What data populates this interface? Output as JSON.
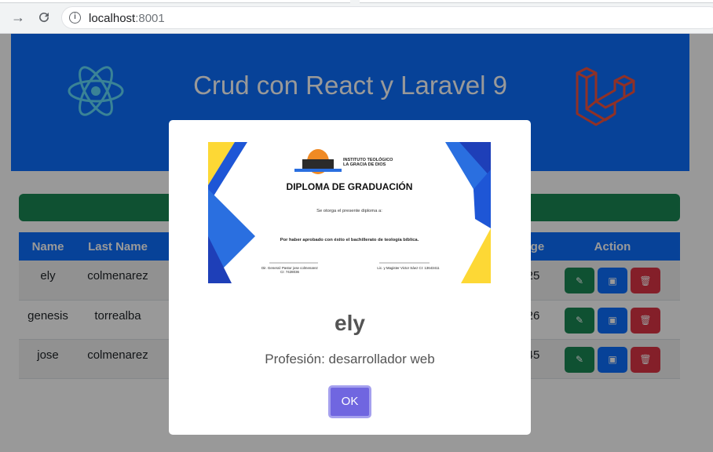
{
  "browser": {
    "url_host": "localhost",
    "url_port": ":8001"
  },
  "header": {
    "title": "Crud con React y Laravel 9",
    "react_logo": "react-logo",
    "laravel_logo": "laravel-logo"
  },
  "table": {
    "headers": {
      "name": "Name",
      "last_name": "Last Name",
      "age": "Age",
      "action": "Action"
    },
    "rows": [
      {
        "name": "ely",
        "last_name": "colmenarez",
        "age": "25"
      },
      {
        "name": "genesis",
        "last_name": "torrealba",
        "age": "26"
      },
      {
        "name": "jose",
        "last_name": "colmenarez",
        "age": "45"
      }
    ]
  },
  "modal": {
    "name": "ely",
    "profession": "Profesión: desarrollador web",
    "ok_label": "OK",
    "diploma": {
      "institute_line1": "INSTITUTO TEOLÓGICO",
      "institute_line2": "LA GRACIA DE DIOS",
      "title": "DIPLOMA DE GRADUACIÓN",
      "subtitle": "Se otorga el presente diploma a:",
      "reason": "Por haber aprobado con éxito el bachillerato de teología bíblica.",
      "sign_left_line1": "Dir. General: Pastor jose colmenarez",
      "sign_left_line2": "CI: 7428036",
      "sign_right": "Lic. y Magister Victor Sáez CI: 13643411"
    }
  },
  "colors": {
    "primary": "#0d6efd",
    "success": "#198754",
    "danger": "#dc3545",
    "confirm": "#7066e0"
  }
}
